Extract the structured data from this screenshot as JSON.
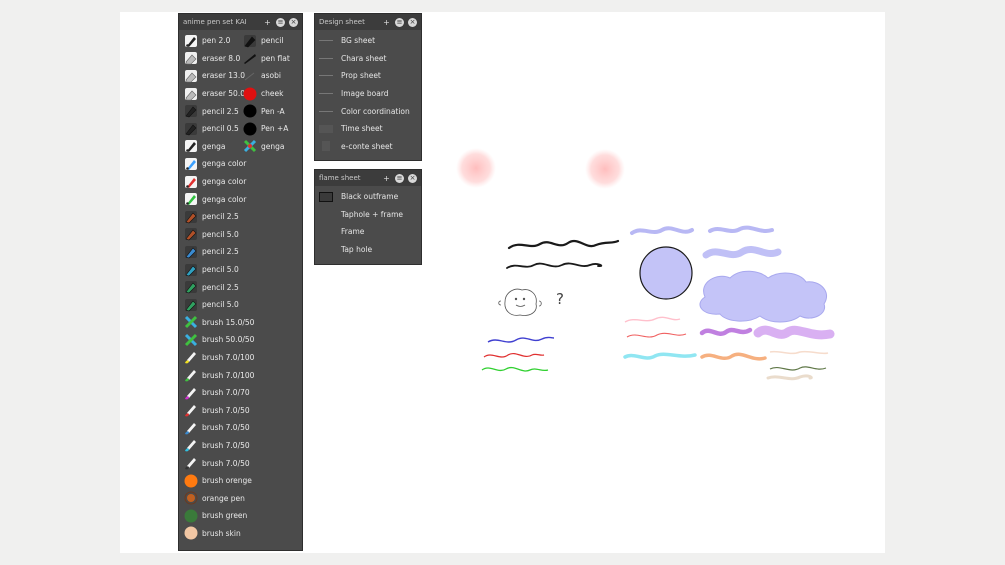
{
  "palettes": {
    "tools": {
      "title": "anime pen set KAI",
      "rows": [
        {
          "a": "pen 2.0",
          "b": "pencil"
        },
        {
          "a": "eraser 8.0",
          "b": "pen flat"
        },
        {
          "a": "eraser 13.0",
          "b": "asobi"
        },
        {
          "a": "eraser 50.0",
          "b": "cheek"
        },
        {
          "a": "pencil 2.5",
          "b": "Pen -A"
        },
        {
          "a": "pencil 0.5",
          "b": "Pen +A"
        },
        {
          "a": "genga",
          "b": "genga"
        },
        {
          "a": "genga color"
        },
        {
          "a": "genga color"
        },
        {
          "a": "genga color"
        },
        {
          "a": "pencil 2.5"
        },
        {
          "a": "pencil 5.0"
        },
        {
          "a": "pencil 2.5"
        },
        {
          "a": "pencil 5.0"
        },
        {
          "a": "pencil 2.5"
        },
        {
          "a": "pencil 5.0"
        },
        {
          "a": "brush 15.0/50"
        },
        {
          "a": "brush 50.0/50"
        },
        {
          "a": "brush 7.0/100"
        },
        {
          "a": "brush 7.0/100"
        },
        {
          "a": "brush 7.0/70"
        },
        {
          "a": "brush 7.0/50"
        },
        {
          "a": "brush 7.0/50"
        },
        {
          "a": "brush 7.0/50"
        },
        {
          "a": "brush 7.0/50"
        },
        {
          "a": "brush orenge"
        },
        {
          "a": "orange pen"
        },
        {
          "a": "brush green"
        },
        {
          "a": "brush skin"
        }
      ]
    },
    "design": {
      "title": "Design sheet",
      "items": [
        "BG sheet",
        "Chara sheet",
        "Prop sheet",
        "Image board",
        "Color coordination",
        "Time sheet",
        "e-conte sheet"
      ]
    },
    "frame": {
      "title": "flame sheet",
      "items": [
        "Black outframe",
        "Taphole + frame",
        "Frame",
        "Tap hole"
      ]
    }
  },
  "canvas_text": {
    "question_mark": "?"
  },
  "colors": {
    "panel_bg": "#4b4b4b",
    "panel_header": "#3c3c3c",
    "cheek_red": "#e01010",
    "brush_orange": "#ff7a10",
    "brush_green": "#3a7a3a",
    "brush_skin": "#f2c7a4",
    "lavender": "#c5c5f7"
  }
}
